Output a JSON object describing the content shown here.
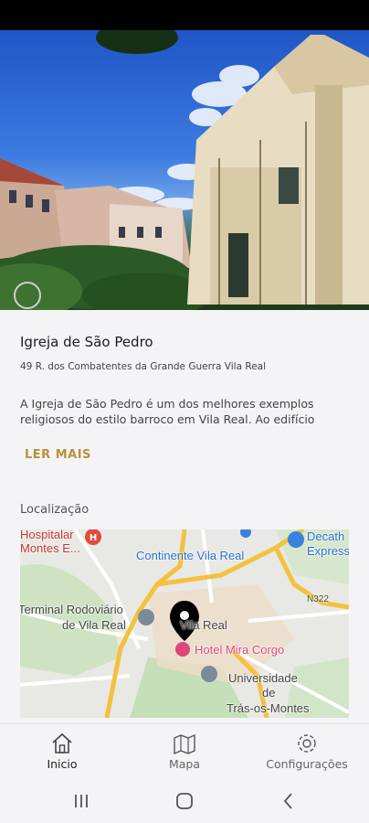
{
  "place": {
    "title": "Igreja de São Pedro",
    "address": "49 R. dos Combatentes da Grande Guerra Vila Real",
    "description": "A Igreja de São Pedro é um dos melhores exemplos religiosos do estilo barroco em Vila Real. Ao edifício original,",
    "read_more_label": "LER MAIS",
    "location_label": "Localização"
  },
  "map": {
    "labels": {
      "hospital": "Hospitalar",
      "hospital_line2": "Montes E...",
      "decathlon": "Decath",
      "decathlon_line2": "Express",
      "continente": "Continente Vila Real",
      "terminal": "Terminal Rodoviário",
      "terminal_line2": "de Vila Real",
      "vila_real": "Vila Real",
      "road": "N322",
      "hotel": "Hotel Mira Corgo",
      "universidade": "Universidade",
      "universidade_line2": "de",
      "tras_os_montes": "Trás-os-Montes"
    }
  },
  "nav": {
    "items": [
      {
        "label": "Inicio",
        "icon": "home-icon"
      },
      {
        "label": "Mapa",
        "icon": "map-icon"
      },
      {
        "label": "Configurações",
        "icon": "gear-icon"
      }
    ]
  },
  "colors": {
    "accent": "#b8923a",
    "marker": "#000000",
    "hotel_pin": "#e0457b",
    "map_road": "#f4c13f"
  }
}
